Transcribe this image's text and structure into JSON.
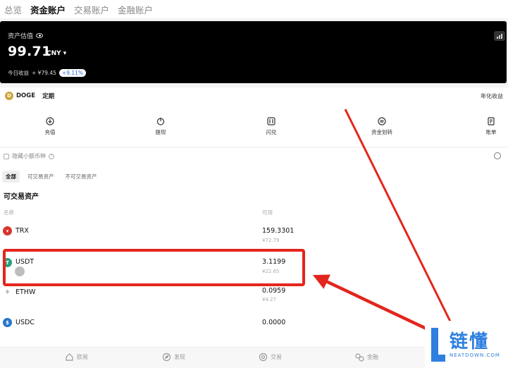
{
  "top_tabs": [
    "总览",
    "资金账户",
    "交易账户",
    "金融账户"
  ],
  "asset_card": {
    "label": "资产估值",
    "value": "99.71",
    "currency": "CNY ▾",
    "income_label": "今日收益",
    "income_value": "+ ¥79.45",
    "income_pct": "+9.11%"
  },
  "doge_row": {
    "icon": "D",
    "name": "DOGE",
    "tag": "定期",
    "right_text": "年化收益"
  },
  "actions": [
    {
      "label": "充值",
      "icon": "deposit-icon"
    },
    {
      "label": "提现",
      "icon": "withdraw-icon"
    },
    {
      "label": "闪兑",
      "icon": "swap-icon"
    },
    {
      "label": "资金划转",
      "icon": "transfer-icon"
    },
    {
      "label": "账单",
      "icon": "bill-icon"
    }
  ],
  "hide_small": "隐藏小额币种",
  "filters": [
    "全部",
    "可交易资产",
    "不可交易资产"
  ],
  "section_title": "可交易资产",
  "columns": {
    "name": "名称",
    "available": "可用"
  },
  "assets": [
    {
      "name": "TRX",
      "amount": "159.3301",
      "cny": "¥72.79",
      "color": "#d9342b"
    },
    {
      "name": "USDT",
      "amount": "3.1199",
      "cny": "¥22.65",
      "color": "#26a17b"
    },
    {
      "name": "ETHW",
      "amount": "0.0959",
      "cny": "¥4.27",
      "color": "#c8c8c8"
    },
    {
      "name": "USDC",
      "amount": "0.0000",
      "cny": "",
      "color": "#2775ca"
    }
  ],
  "bottom_nav": [
    {
      "label": "欧易",
      "icon": "home-icon"
    },
    {
      "label": "发现",
      "icon": "discover-icon"
    },
    {
      "label": "交易",
      "icon": "trade-icon"
    },
    {
      "label": "金融",
      "icon": "finance-icon"
    }
  ],
  "watermark": {
    "main": "链懂",
    "sub": "NEATDOWN.COM"
  },
  "accent_colors": {
    "annotation_red": "#e3261d",
    "brand_blue": "#2e7fe0",
    "badge_blue": "#2a64d8"
  }
}
